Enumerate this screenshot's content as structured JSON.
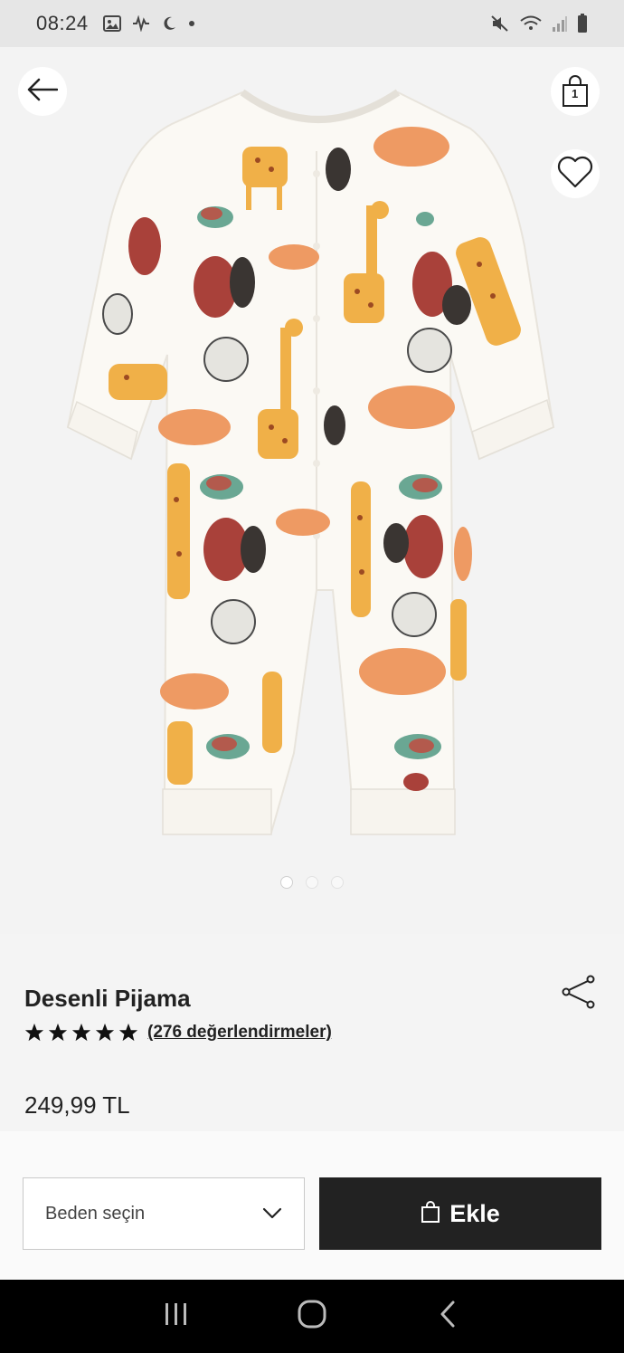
{
  "status_bar": {
    "time": "08:24",
    "icons_left": [
      "gallery-icon",
      "signal-wave-icon",
      "moon-icon",
      "dot-icon"
    ],
    "icons_right": [
      "mute-icon",
      "wifi-icon",
      "cell-signal-icon",
      "battery-icon"
    ]
  },
  "header": {
    "back_icon": "arrow-left-icon",
    "bag_icon": "shopping-bag-icon",
    "bag_count": "1",
    "favorite_icon": "heart-icon"
  },
  "gallery": {
    "image_alt": "product-image",
    "total_images": 3,
    "active_index": 0
  },
  "product": {
    "title": "Desenli Pijama",
    "rating": 5,
    "max_rating": 5,
    "reviews_label": "(276 değerlendirmeler)",
    "price": "249,99 TL",
    "share_icon": "share-icon"
  },
  "actions": {
    "size_placeholder": "Beden seçin",
    "add_label": "Ekle",
    "add_icon": "shopping-bag-icon"
  },
  "nav": {
    "recents_icon": "recents-icon",
    "home_icon": "home-icon",
    "back_icon": "back-chevron-icon"
  },
  "colors": {
    "primary_button": "#222222",
    "background": "#f4f4f4",
    "giraffe": "#f0b048",
    "fox": "#ee9a63",
    "beaver": "#a9413a",
    "turtle": "#6aa793"
  }
}
